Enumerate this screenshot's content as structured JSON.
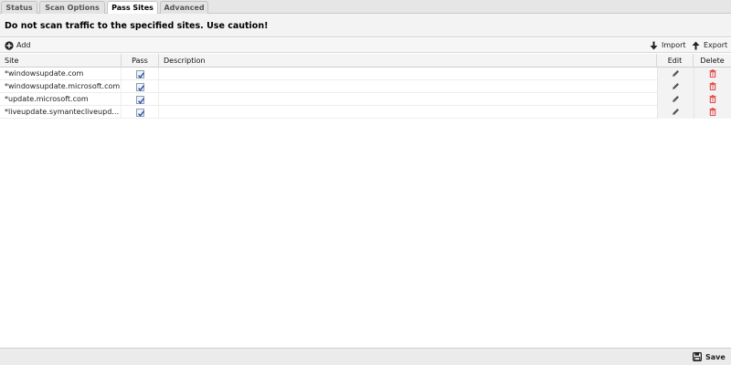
{
  "tabs": [
    {
      "label": "Status",
      "active": false
    },
    {
      "label": "Scan Options",
      "active": false
    },
    {
      "label": "Pass Sites",
      "active": true
    },
    {
      "label": "Advanced",
      "active": false
    }
  ],
  "heading": "Do not scan traffic to the specified sites. Use caution!",
  "toolbar": {
    "add_label": "Add",
    "import_label": "Import",
    "export_label": "Export"
  },
  "grid": {
    "columns": [
      "Site",
      "Pass",
      "Description",
      "Edit",
      "Delete"
    ],
    "rows": [
      {
        "site": "*windowsupdate.com",
        "pass": true,
        "description": ""
      },
      {
        "site": "*windowsupdate.microsoft.com",
        "pass": true,
        "description": ""
      },
      {
        "site": "*update.microsoft.com",
        "pass": true,
        "description": ""
      },
      {
        "site": "*liveupdate.symantecliveupdat...",
        "pass": true,
        "description": ""
      }
    ]
  },
  "footer": {
    "save_label": "Save"
  },
  "icons": {
    "add": "plus-circle-icon",
    "import": "arrow-down-icon",
    "export": "arrow-up-icon",
    "edit": "pencil-icon",
    "delete": "trash-icon",
    "save": "floppy-disk-icon",
    "pass": "checkbox-checked-icon"
  },
  "colors": {
    "delete_icon": "#e03a3a",
    "checkbox_check": "#2a4d9c",
    "edit_icon": "#555555"
  }
}
